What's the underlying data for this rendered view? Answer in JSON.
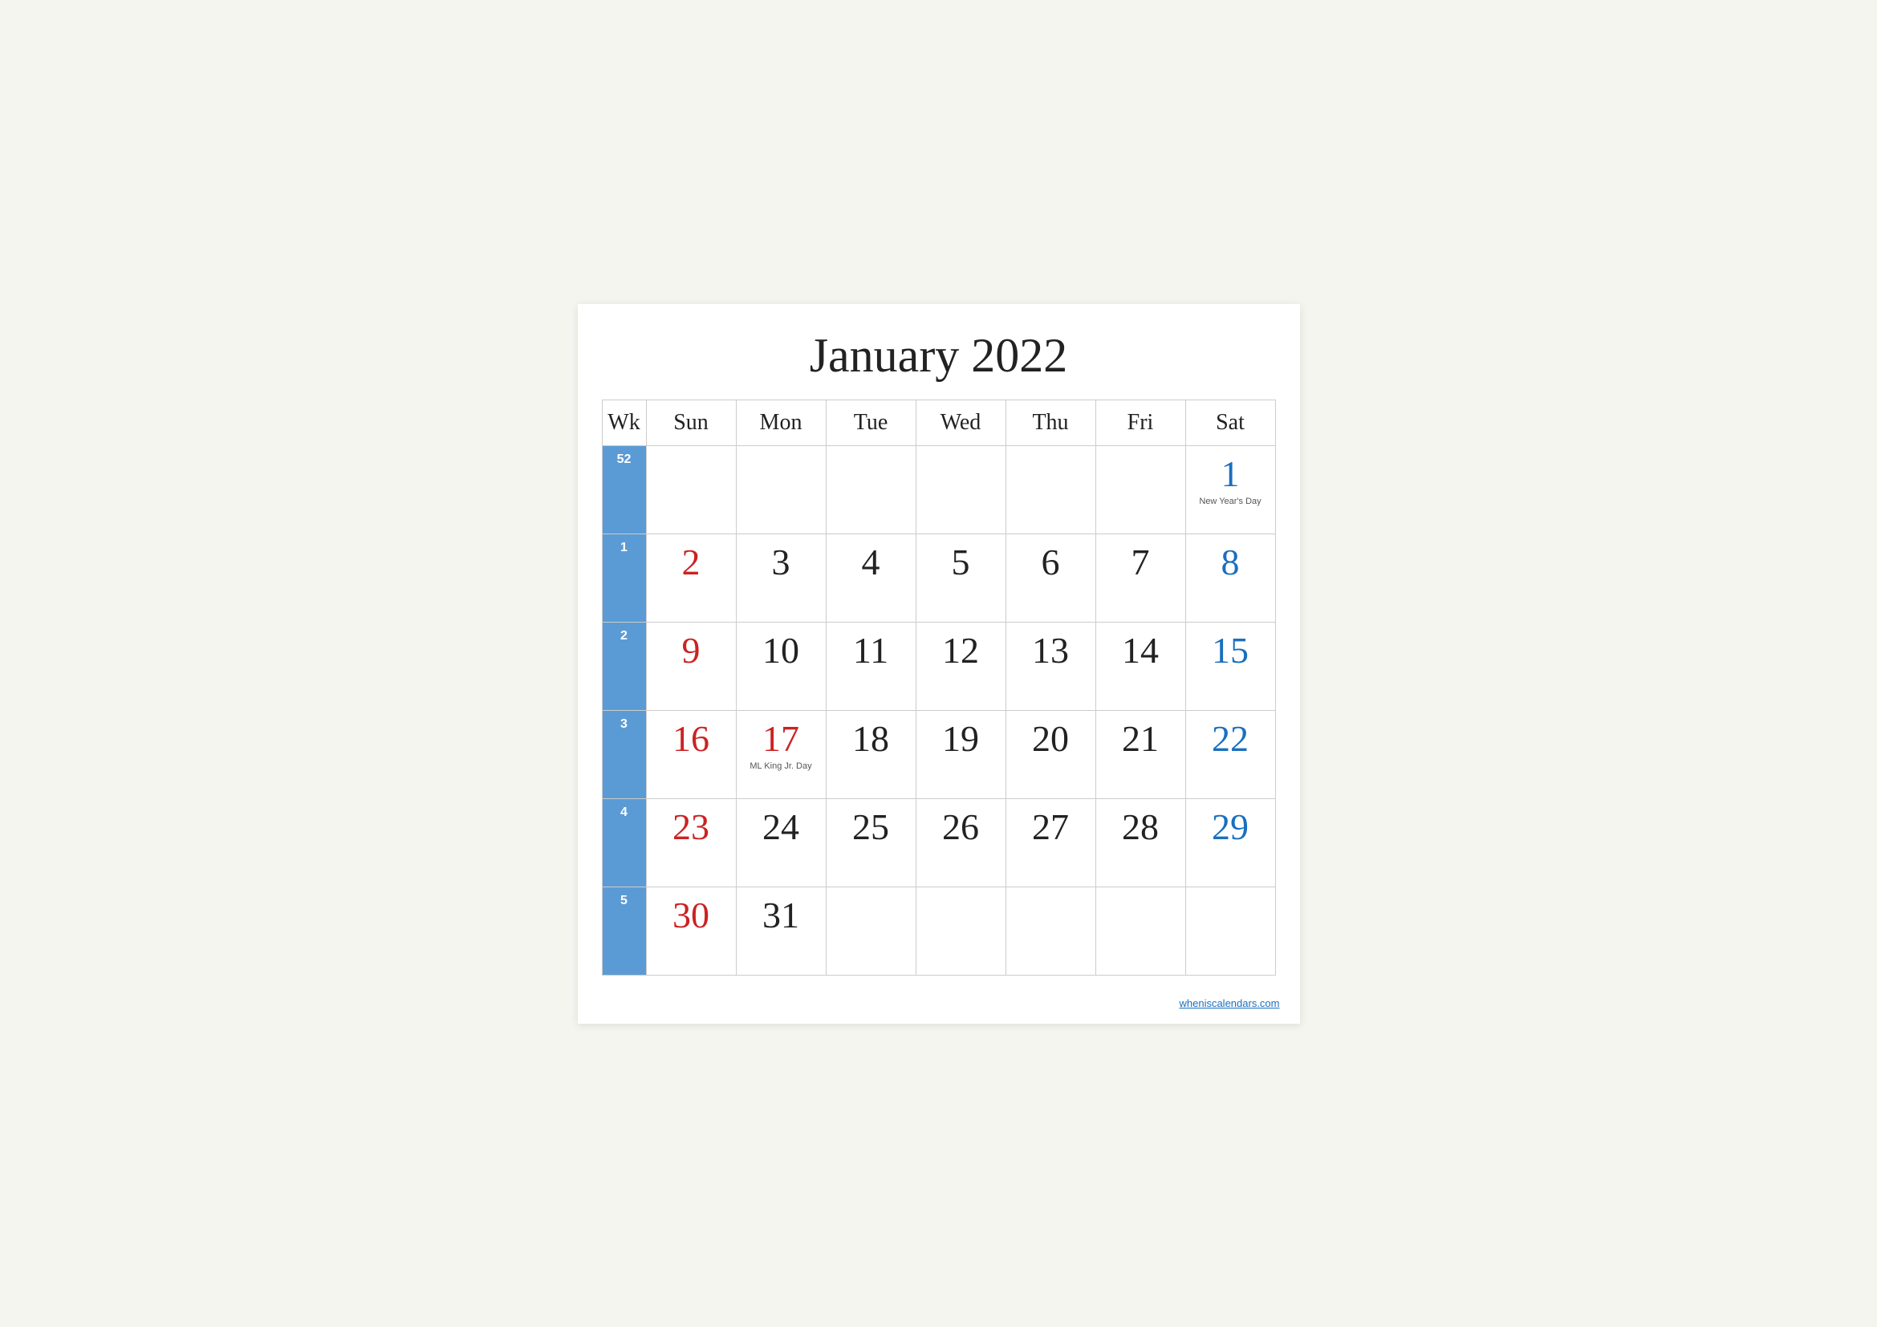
{
  "title": "January 2022",
  "header": {
    "week_col": "Wk",
    "days": [
      {
        "label": "Sun",
        "color": "red"
      },
      {
        "label": "Mon",
        "color": "black"
      },
      {
        "label": "Tue",
        "color": "black"
      },
      {
        "label": "Wed",
        "color": "black"
      },
      {
        "label": "Thu",
        "color": "black"
      },
      {
        "label": "Fri",
        "color": "black"
      },
      {
        "label": "Sat",
        "color": "blue"
      }
    ]
  },
  "weeks": [
    {
      "week_num": "52",
      "days": [
        {
          "num": "",
          "color": "black",
          "holiday": ""
        },
        {
          "num": "",
          "color": "black",
          "holiday": ""
        },
        {
          "num": "",
          "color": "black",
          "holiday": ""
        },
        {
          "num": "",
          "color": "black",
          "holiday": ""
        },
        {
          "num": "",
          "color": "black",
          "holiday": ""
        },
        {
          "num": "",
          "color": "black",
          "holiday": ""
        },
        {
          "num": "1",
          "color": "blue",
          "holiday": "New Year's Day"
        }
      ]
    },
    {
      "week_num": "1",
      "days": [
        {
          "num": "2",
          "color": "red",
          "holiday": ""
        },
        {
          "num": "3",
          "color": "black",
          "holiday": ""
        },
        {
          "num": "4",
          "color": "black",
          "holiday": ""
        },
        {
          "num": "5",
          "color": "black",
          "holiday": ""
        },
        {
          "num": "6",
          "color": "black",
          "holiday": ""
        },
        {
          "num": "7",
          "color": "black",
          "holiday": ""
        },
        {
          "num": "8",
          "color": "blue",
          "holiday": ""
        }
      ]
    },
    {
      "week_num": "2",
      "days": [
        {
          "num": "9",
          "color": "red",
          "holiday": ""
        },
        {
          "num": "10",
          "color": "black",
          "holiday": ""
        },
        {
          "num": "11",
          "color": "black",
          "holiday": ""
        },
        {
          "num": "12",
          "color": "black",
          "holiday": ""
        },
        {
          "num": "13",
          "color": "black",
          "holiday": ""
        },
        {
          "num": "14",
          "color": "black",
          "holiday": ""
        },
        {
          "num": "15",
          "color": "blue",
          "holiday": ""
        }
      ]
    },
    {
      "week_num": "3",
      "days": [
        {
          "num": "16",
          "color": "red",
          "holiday": ""
        },
        {
          "num": "17",
          "color": "red",
          "holiday": "ML King Jr. Day"
        },
        {
          "num": "18",
          "color": "black",
          "holiday": ""
        },
        {
          "num": "19",
          "color": "black",
          "holiday": ""
        },
        {
          "num": "20",
          "color": "black",
          "holiday": ""
        },
        {
          "num": "21",
          "color": "black",
          "holiday": ""
        },
        {
          "num": "22",
          "color": "blue",
          "holiday": ""
        }
      ]
    },
    {
      "week_num": "4",
      "days": [
        {
          "num": "23",
          "color": "red",
          "holiday": ""
        },
        {
          "num": "24",
          "color": "black",
          "holiday": ""
        },
        {
          "num": "25",
          "color": "black",
          "holiday": ""
        },
        {
          "num": "26",
          "color": "black",
          "holiday": ""
        },
        {
          "num": "27",
          "color": "black",
          "holiday": ""
        },
        {
          "num": "28",
          "color": "black",
          "holiday": ""
        },
        {
          "num": "29",
          "color": "blue",
          "holiday": ""
        }
      ]
    },
    {
      "week_num": "5",
      "days": [
        {
          "num": "30",
          "color": "red",
          "holiday": ""
        },
        {
          "num": "31",
          "color": "black",
          "holiday": ""
        },
        {
          "num": "",
          "color": "black",
          "holiday": ""
        },
        {
          "num": "",
          "color": "black",
          "holiday": ""
        },
        {
          "num": "",
          "color": "black",
          "holiday": ""
        },
        {
          "num": "",
          "color": "black",
          "holiday": ""
        },
        {
          "num": "",
          "color": "black",
          "holiday": ""
        }
      ]
    }
  ],
  "watermark": {
    "text": "wheniscalendars.com",
    "url": "#"
  }
}
